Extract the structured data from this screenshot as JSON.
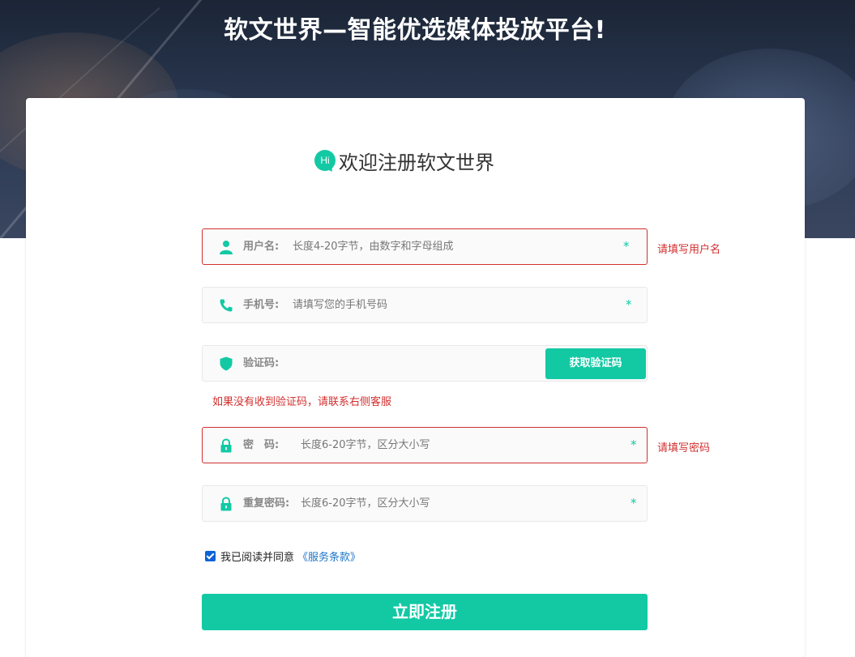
{
  "hero": {
    "title": "软文世界—智能优选媒体投放平台!"
  },
  "welcome": {
    "badge": "Hi",
    "text": "欢迎注册软文世界"
  },
  "fields": {
    "username": {
      "label": "用户名:",
      "placeholder": "长度4-20字节，由数字和字母组成",
      "required_mark": "*",
      "error": "请填写用户名",
      "icon": "user-icon"
    },
    "phone": {
      "label": "手机号:",
      "placeholder": "请填写您的手机号码",
      "required_mark": "*",
      "icon": "phone-icon"
    },
    "code": {
      "label": "验证码:",
      "placeholder": "",
      "button": "获取验证码",
      "hint": "如果没有收到验证码，请联系右侧客服",
      "icon": "shield-icon"
    },
    "password": {
      "label": "密　码:",
      "placeholder": "长度6-20字节，区分大小写",
      "required_mark": "*",
      "error": "请填写密码",
      "icon": "lock-icon"
    },
    "confirm": {
      "label": "重复密码:",
      "placeholder": "长度6-20字节，区分大小写",
      "required_mark": "*",
      "icon": "lock-icon"
    }
  },
  "agreement": {
    "text": "我已阅读并同意",
    "link": "《服务条款》",
    "checked": true
  },
  "submit": {
    "label": "立即注册"
  },
  "colors": {
    "accent": "#12c9a4",
    "error": "#d32f2f",
    "link": "#1a73c9"
  }
}
